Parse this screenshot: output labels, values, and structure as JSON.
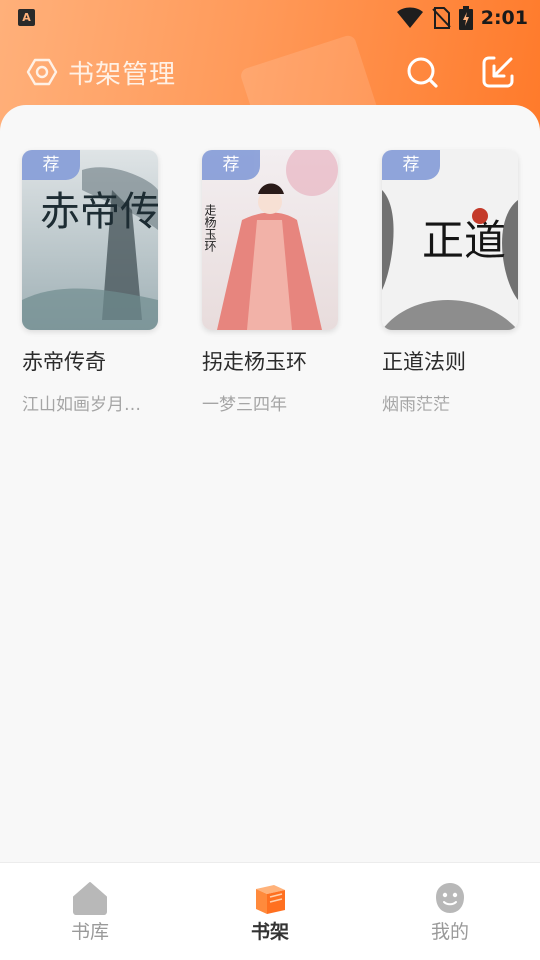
{
  "status_bar": {
    "app_icon_letter": "A",
    "time": "2:01"
  },
  "header": {
    "title": "书架管理"
  },
  "books": [
    {
      "badge": "荐",
      "title": "赤帝传奇",
      "author": "江山如画岁月…",
      "cover_text": "赤帝传奇"
    },
    {
      "badge": "荐",
      "title": "拐走杨玉环",
      "author": "一梦三四年",
      "cover_text": "走杨玉环"
    },
    {
      "badge": "荐",
      "title": "正道法则",
      "author": "烟雨茫茫",
      "cover_text": "正道"
    }
  ],
  "tabs": [
    {
      "label": "书库",
      "icon": "home-icon"
    },
    {
      "label": "书架",
      "icon": "bookshelf-icon",
      "active": true
    },
    {
      "label": "我的",
      "icon": "profile-icon"
    }
  ],
  "colors": {
    "header_start": "#ffb07a",
    "header_end": "#ff7a2a",
    "badge": "#8aa0d8",
    "active_tab_icon": "#ff8a3c"
  }
}
